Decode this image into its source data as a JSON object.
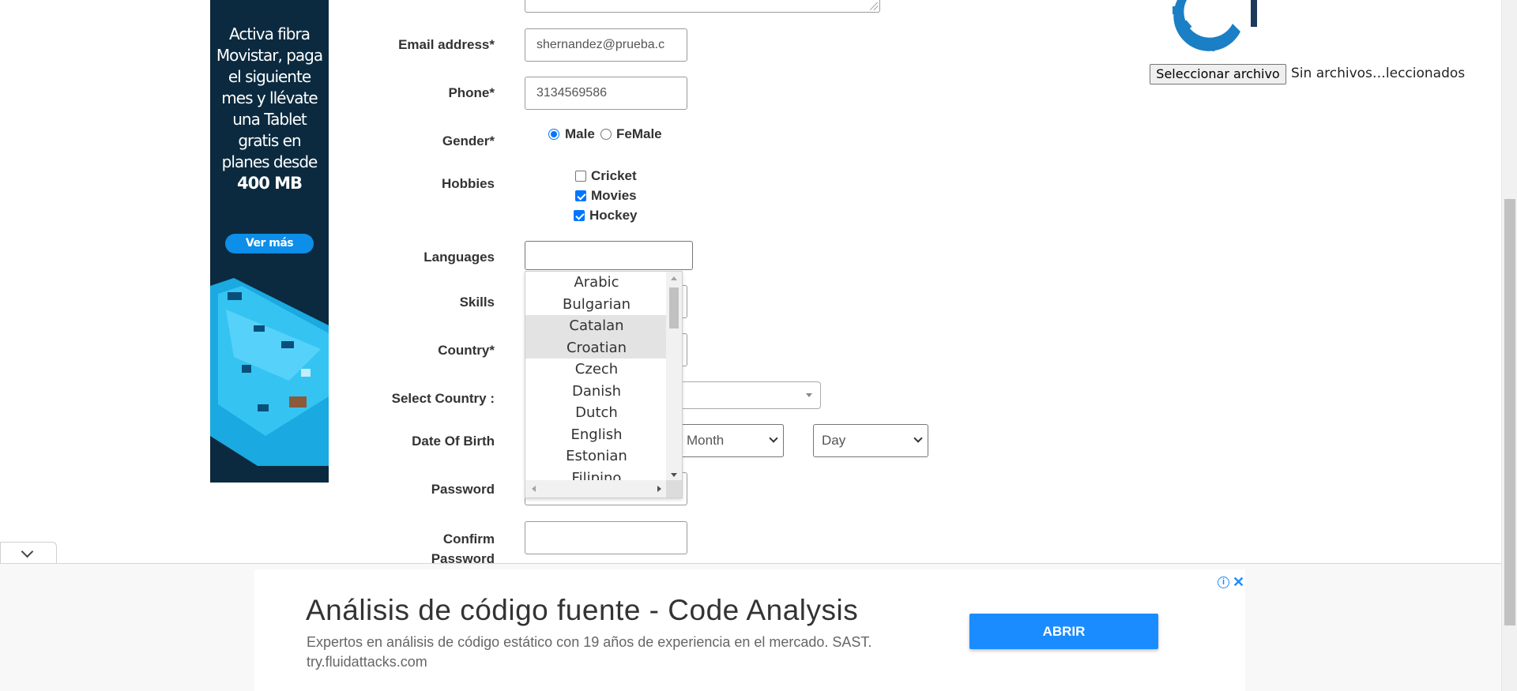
{
  "side_ad": {
    "text_lines": [
      "Activa fibra",
      "Movistar, paga",
      "el siguiente",
      "mes y llévate",
      "una Tablet",
      "gratis en",
      "planes desde"
    ],
    "highlight": "400 MB",
    "button_label": "Ver más"
  },
  "form": {
    "email": {
      "label": "Email address*",
      "value": "shernandez@prueba.c"
    },
    "phone": {
      "label": "Phone*",
      "value": "3134569586"
    },
    "gender": {
      "label": "Gender*",
      "options": [
        "Male",
        "FeMale"
      ],
      "selected": "Male"
    },
    "hobbies": {
      "label": "Hobbies",
      "items": [
        {
          "label": "Cricket",
          "checked": false
        },
        {
          "label": "Movies",
          "checked": true
        },
        {
          "label": "Hockey",
          "checked": true
        }
      ]
    },
    "languages": {
      "label": "Languages",
      "options": [
        "Arabic",
        "Bulgarian",
        "Catalan",
        "Croatian",
        "Czech",
        "Danish",
        "Dutch",
        "English",
        "Estonian",
        "Filipino"
      ],
      "highlighted": [
        "Catalan",
        "Croatian"
      ]
    },
    "skills": {
      "label": "Skills"
    },
    "country": {
      "label": "Country*"
    },
    "select_country": {
      "label": "Select Country :"
    },
    "dob": {
      "label": "Date Of Birth",
      "month_placeholder": "Month",
      "day_placeholder": "Day"
    },
    "password": {
      "label": "Password"
    },
    "confirm_password": {
      "label_line1": "Confirm",
      "label_line2": "Password"
    }
  },
  "file_upload": {
    "button_label": "Seleccionar archivo",
    "status": "Sin archivos…leccionados"
  },
  "bottom_ad": {
    "headline": "Análisis de código fuente - Code Analysis",
    "description": "Expertos en análisis de código estático con 19 años de experiencia en el mercado. SAST.",
    "url": "try.fluidattacks.com",
    "cta": "ABRIR",
    "info_icon": "info-icon",
    "close_icon": "close-icon"
  },
  "colors": {
    "accent_blue": "#0075ff",
    "ad_blue": "#1a8cff",
    "side_ad_bg": "#0b2a3f"
  }
}
